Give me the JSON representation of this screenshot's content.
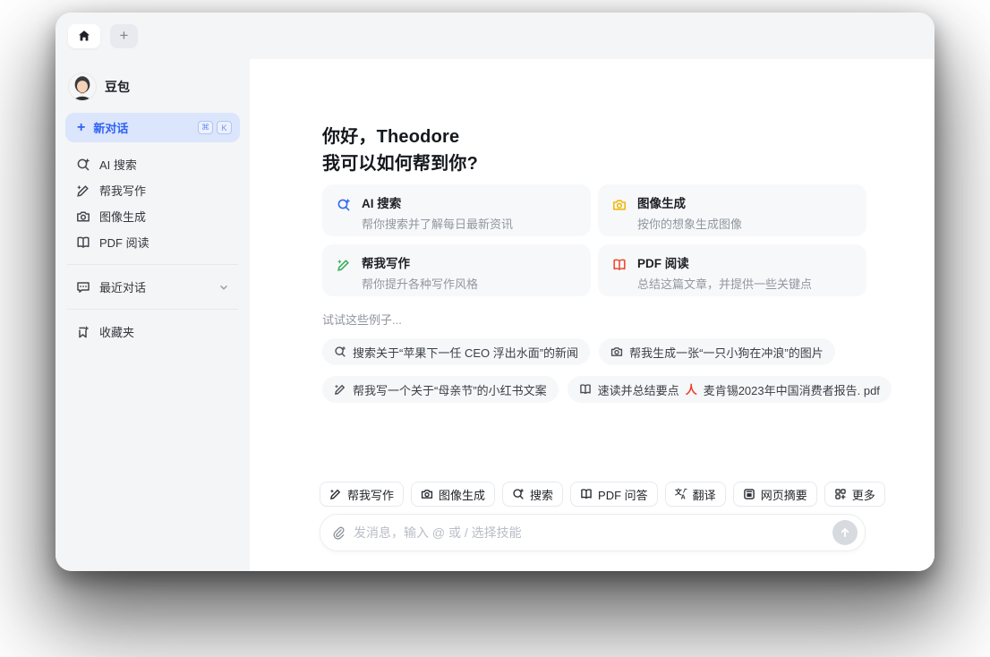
{
  "colors": {
    "accent_blue": "#2e62f5",
    "search_blue": "#3468f5",
    "image_yellow": "#f0b90b",
    "write_green": "#3dae5b",
    "pdf_red": "#ee4e34",
    "pdf_file_red": "#ee3f2d"
  },
  "tabbar": {
    "new_tab_label": "+"
  },
  "sidebar": {
    "profile": {
      "name": "豆包"
    },
    "new_chat": {
      "label": "新对话",
      "plus": "+",
      "key1": "⌘",
      "key2": "K"
    },
    "nav": [
      {
        "label": "AI 搜索"
      },
      {
        "label": "帮我写作"
      },
      {
        "label": "图像生成"
      },
      {
        "label": "PDF 阅读"
      }
    ],
    "recent": {
      "label": "最近对话"
    },
    "favorites": {
      "label": "收藏夹"
    }
  },
  "main": {
    "greeting_line1": "你好，Theodore",
    "greeting_line2": "我可以如何帮到你?",
    "cards": [
      {
        "title": "AI 搜索",
        "desc": "帮你搜索并了解每日最新资讯",
        "color": "#3468f5"
      },
      {
        "title": "图像生成",
        "desc": "按你的想象生成图像",
        "color": "#f0b90b"
      },
      {
        "title": "帮我写作",
        "desc": "帮你提升各种写作风格",
        "color": "#3dae5b"
      },
      {
        "title": "PDF 阅读",
        "desc": "总结这篇文章，并提供一些关键点",
        "color": "#ee4e34"
      }
    ],
    "examples_hint": "试试这些例子...",
    "example_chips": [
      {
        "label": "搜索关于“苹果下一任 CEO 浮出水面”的新闻"
      },
      {
        "label": "帮我生成一张“一只小狗在冲浪”的图片"
      },
      {
        "label": "帮我写一个关于“母亲节”的小红书文案"
      },
      {
        "label": "速读并总结要点",
        "pdf_glyph": "人",
        "file": "麦肯锡2023年中国消费者报告. pdf"
      }
    ],
    "skills": [
      {
        "label": "帮我写作"
      },
      {
        "label": "图像生成"
      },
      {
        "label": "搜索"
      },
      {
        "label": "PDF 问答"
      },
      {
        "label": "翻译"
      },
      {
        "label": "网页摘要"
      },
      {
        "label": "更多"
      }
    ],
    "input": {
      "placeholder": "发消息，输入 @ 或 / 选择技能"
    }
  }
}
